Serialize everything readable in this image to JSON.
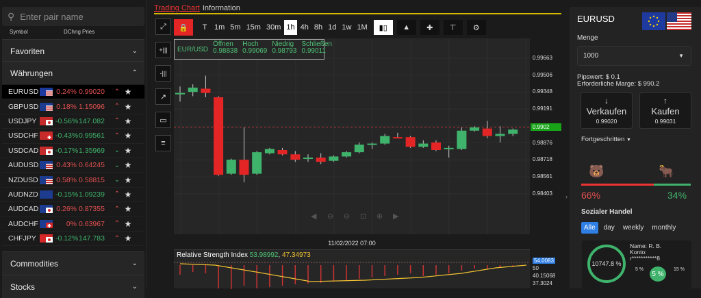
{
  "search": {
    "placeholder": "Enter pair name"
  },
  "list_header": {
    "symbol": "Symbol",
    "change": "DChng",
    "price": "Pries"
  },
  "sections": {
    "favorites": "Favoriten",
    "currencies": "Währungen",
    "commodities": "Commodities",
    "stocks": "Stocks"
  },
  "pairs": [
    {
      "sym": "EURUSD",
      "chg": "0.24%",
      "price": "0.99020",
      "dir": "up",
      "flag": "eu-us",
      "selected": true
    },
    {
      "sym": "GBPUSD",
      "chg": "0.18%",
      "price": "1.15096",
      "dir": "up",
      "flag": "gb-us"
    },
    {
      "sym": "USDJPY",
      "chg": "-0.56%",
      "price": "147.082",
      "dir": "up",
      "flag": "us-jp"
    },
    {
      "sym": "USDCHF",
      "chg": "-0.43%",
      "price": "0.99561",
      "dir": "up",
      "flag": "us-ch"
    },
    {
      "sym": "USDCAD",
      "chg": "-0.17%",
      "price": "1.35969",
      "dir": "down",
      "flag": "us-ca"
    },
    {
      "sym": "AUDUSD",
      "chg": "0.43%",
      "price": "0.64245",
      "dir": "down",
      "flag": "au-us"
    },
    {
      "sym": "NZDUSD",
      "chg": "0.58%",
      "price": "0.58815",
      "dir": "down",
      "flag": "nz-us"
    },
    {
      "sym": "AUDNZD",
      "chg": "-0.15%",
      "price": "1.09239",
      "dir": "up",
      "flag": "au-nz"
    },
    {
      "sym": "AUDCAD",
      "chg": "0.26%",
      "price": "0.87355",
      "dir": "up",
      "flag": "au-ca"
    },
    {
      "sym": "AUDCHF",
      "chg": "0%",
      "price": "0.63967",
      "dir": "up",
      "flag": "au-ch"
    },
    {
      "sym": "CHFJPY",
      "chg": "-0.12%",
      "price": "147.783",
      "dir": "up",
      "flag": "ch-jp"
    }
  ],
  "tabs": {
    "trading_chart": "Trading Chart",
    "information": "Information"
  },
  "timeframes": [
    "T",
    "1m",
    "5m",
    "15m",
    "30m",
    "1h",
    "4h",
    "8h",
    "1d",
    "1w",
    "1M"
  ],
  "selected_timeframe": "1h",
  "ohlc": {
    "pair": "EUR/USD",
    "open_label": "Öffnen",
    "open": "0.98838",
    "high_label": "Hoch",
    "high": "0.99069",
    "low_label": "Niedrig",
    "low": "0.98793",
    "close_label": "Schließen",
    "close": "0.99011"
  },
  "chart_data": {
    "type": "candlestick",
    "y_ticks": [
      "0.99663",
      "0.99506",
      "0.99348",
      "0.99191",
      "0.99033",
      "0.98876",
      "0.98718",
      "0.98561",
      "0.98403"
    ],
    "ylim": [
      0.9832,
      0.9972
    ],
    "current_price": "0.9902",
    "candles": [
      {
        "o": 0.9933,
        "h": 0.994,
        "l": 0.9926,
        "c": 0.9934
      },
      {
        "o": 0.9935,
        "h": 0.9942,
        "l": 0.9931,
        "c": 0.9939
      },
      {
        "o": 0.9938,
        "h": 0.995,
        "l": 0.993,
        "c": 0.9934
      },
      {
        "o": 0.993,
        "h": 0.9931,
        "l": 0.9857,
        "c": 0.9858
      },
      {
        "o": 0.9859,
        "h": 0.9873,
        "l": 0.9858,
        "c": 0.9872
      },
      {
        "o": 0.9872,
        "h": 0.9902,
        "l": 0.9851,
        "c": 0.9858
      },
      {
        "o": 0.9859,
        "h": 0.988,
        "l": 0.9858,
        "c": 0.9879
      },
      {
        "o": 0.9878,
        "h": 0.9883,
        "l": 0.9877,
        "c": 0.9882
      },
      {
        "o": 0.9881,
        "h": 0.9883,
        "l": 0.9876,
        "c": 0.9877
      },
      {
        "o": 0.9877,
        "h": 0.988,
        "l": 0.987,
        "c": 0.9872
      },
      {
        "o": 0.9873,
        "h": 0.9877,
        "l": 0.987,
        "c": 0.9874
      },
      {
        "o": 0.9874,
        "h": 0.9878,
        "l": 0.9868,
        "c": 0.987
      },
      {
        "o": 0.9871,
        "h": 0.9876,
        "l": 0.987,
        "c": 0.9875
      },
      {
        "o": 0.9875,
        "h": 0.988,
        "l": 0.9874,
        "c": 0.9879
      },
      {
        "o": 0.9879,
        "h": 0.9888,
        "l": 0.9878,
        "c": 0.9886
      },
      {
        "o": 0.9886,
        "h": 0.9888,
        "l": 0.9882,
        "c": 0.9887
      },
      {
        "o": 0.9887,
        "h": 0.9896,
        "l": 0.9886,
        "c": 0.9894
      },
      {
        "o": 0.9893,
        "h": 0.9897,
        "l": 0.9892,
        "c": 0.9892
      },
      {
        "o": 0.9893,
        "h": 0.9894,
        "l": 0.9883,
        "c": 0.9884
      },
      {
        "o": 0.9884,
        "h": 0.989,
        "l": 0.9883,
        "c": 0.9887
      },
      {
        "o": 0.9888,
        "h": 0.989,
        "l": 0.988,
        "c": 0.9881
      },
      {
        "o": 0.9882,
        "h": 0.9885,
        "l": 0.9874,
        "c": 0.9883
      },
      {
        "o": 0.9882,
        "h": 0.9902,
        "l": 0.9881,
        "c": 0.9899
      },
      {
        "o": 0.9899,
        "h": 0.9903,
        "l": 0.9898,
        "c": 0.9902
      },
      {
        "o": 0.9901,
        "h": 0.9908,
        "l": 0.9892,
        "c": 0.9894
      },
      {
        "o": 0.9894,
        "h": 0.9903,
        "l": 0.9888,
        "c": 0.9896
      },
      {
        "o": 0.9896,
        "h": 0.9901,
        "l": 0.9894,
        "c": 0.99
      }
    ],
    "x_label_time": "11/02/2022 07:00",
    "rsi_ticks": [
      "54.0083",
      "50",
      "40.15068",
      "37.3024"
    ]
  },
  "rsi": {
    "name": "Relative Strength Index",
    "v1": "53.98992",
    "v2": "47.34973"
  },
  "right": {
    "pair": "EURUSD",
    "menge_label": "Menge",
    "amount": "1000",
    "pipvalue": "Pipswert: $ 0.1",
    "margin": "Erforderliche Marge: $ 990.2",
    "sell_label": "Verkaufen",
    "sell_price": "0.99020",
    "buy_label": "Kaufen",
    "buy_price": "0.99031",
    "advanced": "Fortgeschritten",
    "bear_pct": "66%",
    "bull_pct": "34%",
    "bear_share": 0.66,
    "social": "Sozialer Handel",
    "seg": [
      "Alle",
      "day",
      "weekly",
      "monthly"
    ],
    "trader_return": "10747.8 %",
    "trader_name": "Name: R. B.",
    "trader_account_label": "Konto:",
    "trader_account": "r***********8",
    "risk_min": "5 %",
    "risk_val": "5 %",
    "risk_max": "15 %",
    "colors": {
      "bear": "#e35050",
      "bull": "#3fb36b",
      "accent": "#2f7ee3"
    }
  }
}
